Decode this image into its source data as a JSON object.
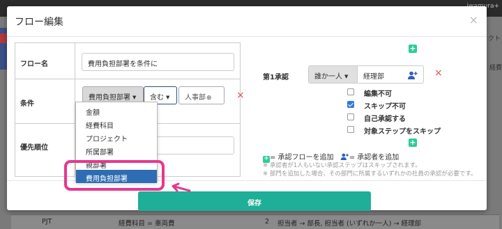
{
  "background": {
    "user_fragment": "iwamura+",
    "right_fragment_1": "クト",
    "right_fragment_2": "経費",
    "row": {
      "code": "PJT",
      "condition": "経費科目 = 車両費",
      "step_no": "2",
      "flow": "担当者 → 部長, 担当者 (いずれか一人) → 経理部"
    }
  },
  "modal": {
    "title": "フロー編集",
    "close_symbol": "×"
  },
  "form": {
    "flow_name_label": "フロー名",
    "flow_name_value": "費用負担部署を条件に",
    "condition_label": "条件",
    "condition_field": "費用負担部署",
    "condition_operator": "含む",
    "condition_value": "人事部",
    "priority_label": "優先順位",
    "remove_symbol": "×"
  },
  "dropdown": {
    "items": [
      "金額",
      "経費科目",
      "プロジェクト",
      "所属部署",
      "親部署",
      "費用負担部署"
    ],
    "selected_index": 5
  },
  "approval": {
    "step_label": "第1承認",
    "approver_type": "誰か一人",
    "approver_value": "経理部",
    "remove_symbol": "×",
    "options": [
      {
        "label": "編集不可",
        "checked": false
      },
      {
        "label": "スキップ不可",
        "checked": true
      },
      {
        "label": "自己承認する",
        "checked": false
      },
      {
        "label": "対象ステップをスキップ",
        "checked": false
      }
    ],
    "legend_add_flow": "= 承認フローを追加",
    "legend_add_approver": "= 承認者を追加",
    "note_1": "※ 承認者が1人もいない承認ステップはスキップされます。",
    "note_2": "※ 部門を追加した場合、その部門に所属するいずれかの社員の承認が必要です。"
  },
  "footer": {
    "save_label": "保存"
  },
  "colors": {
    "accent": "#1fae97",
    "add_green": "#2ecc9a",
    "selected_blue": "#2e6db4",
    "highlight": "#e8368f",
    "danger": "#d9534f"
  }
}
